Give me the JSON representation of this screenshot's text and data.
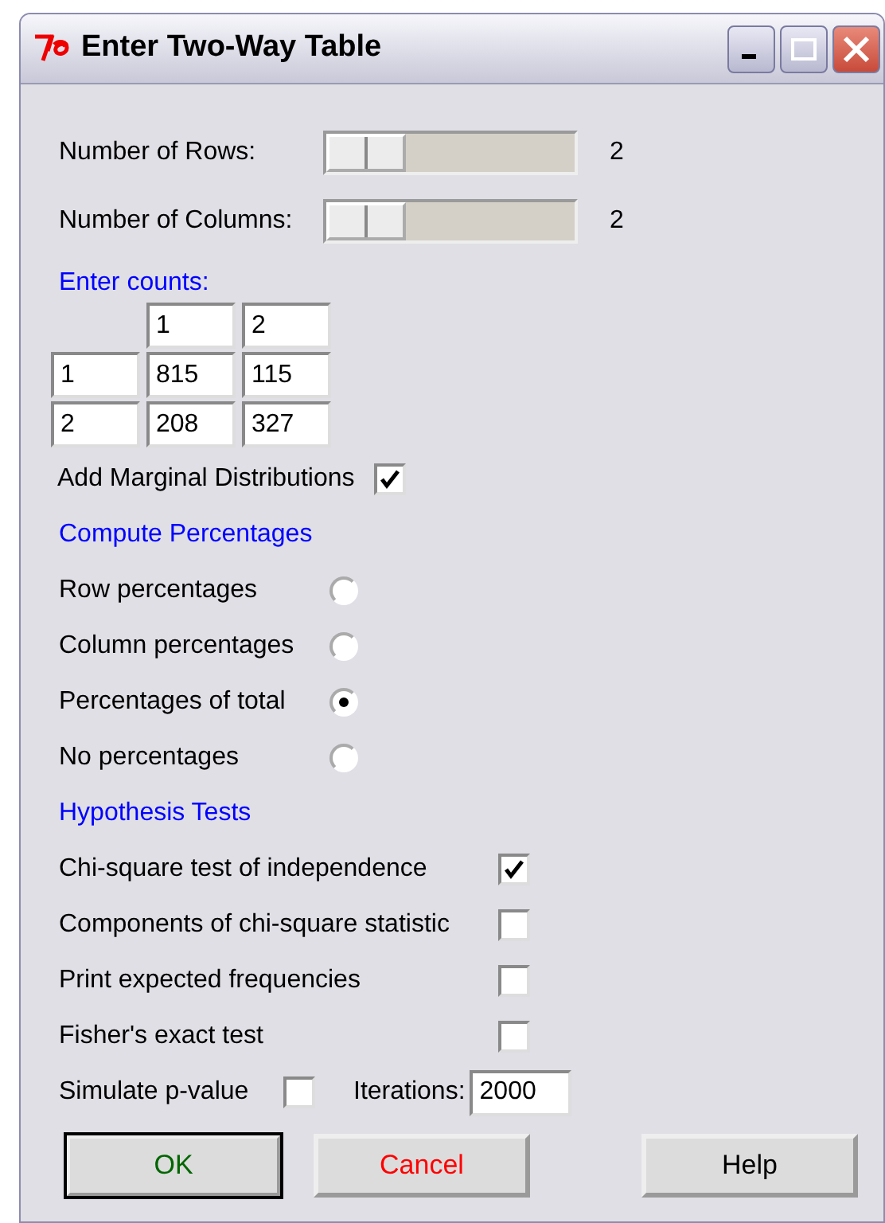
{
  "window": {
    "title": "Enter Two-Way Table"
  },
  "sliders": [
    {
      "label": "Number of Rows:",
      "reading": "2"
    },
    {
      "label": "Number of Columns:",
      "reading": "2"
    }
  ],
  "counts": {
    "heading": "Enter counts:",
    "column_headers": [
      "1",
      "2"
    ],
    "rows": [
      {
        "header": "1",
        "values": [
          "815",
          "115"
        ]
      },
      {
        "header": "2",
        "values": [
          "208",
          "327"
        ]
      }
    ]
  },
  "marginal": {
    "label": "Add Marginal Distributions",
    "checked": true
  },
  "percentages": {
    "heading": "Compute Percentages",
    "options": [
      {
        "label": "Row percentages",
        "selected": false
      },
      {
        "label": "Column percentages",
        "selected": false
      },
      {
        "label": "Percentages of total",
        "selected": true
      },
      {
        "label": "No percentages",
        "selected": false
      }
    ]
  },
  "tests": {
    "heading": "Hypothesis Tests",
    "options": [
      {
        "label": "Chi-square test of independence",
        "checked": true
      },
      {
        "label": "Components of chi-square statistic",
        "checked": false
      },
      {
        "label": "Print expected frequencies",
        "checked": false
      },
      {
        "label": "Fisher's exact test",
        "checked": false
      }
    ]
  },
  "simulate": {
    "label": "Simulate p-value",
    "checked": false,
    "iterations_label": "Iterations:",
    "iterations": "2000"
  },
  "buttons": [
    {
      "label": "OK",
      "kind": "ok"
    },
    {
      "label": "Cancel",
      "kind": "cancel"
    },
    {
      "label": "Help",
      "kind": "help"
    }
  ]
}
